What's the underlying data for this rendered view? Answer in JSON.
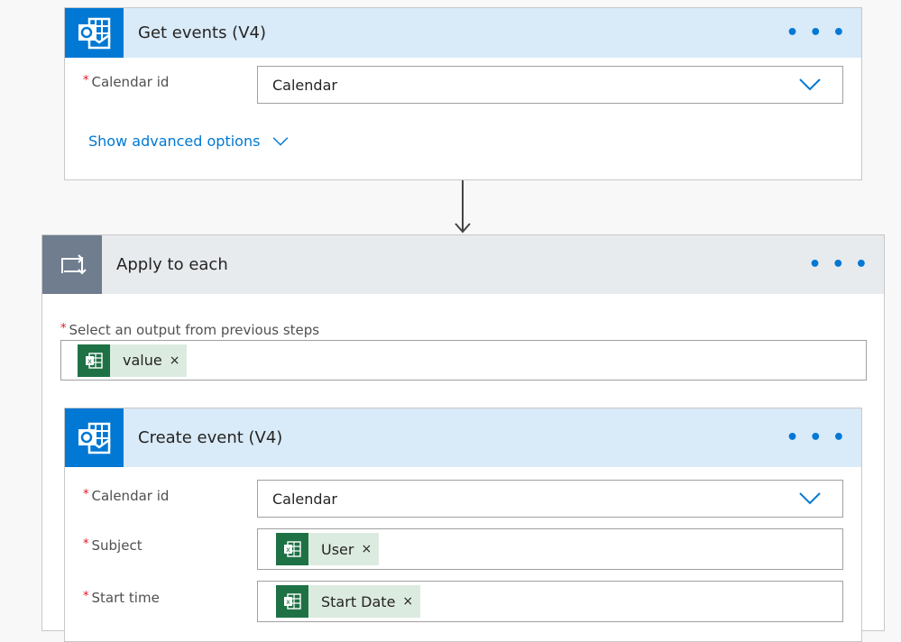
{
  "get_events": {
    "title": "Get events (V4)",
    "calendar_label": "Calendar id",
    "calendar_value": "Calendar",
    "advanced": "Show advanced options",
    "more": "• • •"
  },
  "apply_each": {
    "title": "Apply to each",
    "output_label": "Select an output from previous steps",
    "token": "value",
    "more": "• • •"
  },
  "create_event": {
    "title": "Create event (V4)",
    "more": "• • •",
    "fields": [
      {
        "label": "Calendar id",
        "value": "Calendar"
      },
      {
        "label": "Subject",
        "token": "User"
      },
      {
        "label": "Start time",
        "token": "Start Date"
      }
    ]
  },
  "required_mark": "*",
  "remove_mark": "×",
  "colors": {
    "outlook": "#0078d4",
    "excel": "#1e7145",
    "loop": "#6f7d8e",
    "link": "#0078d4"
  }
}
